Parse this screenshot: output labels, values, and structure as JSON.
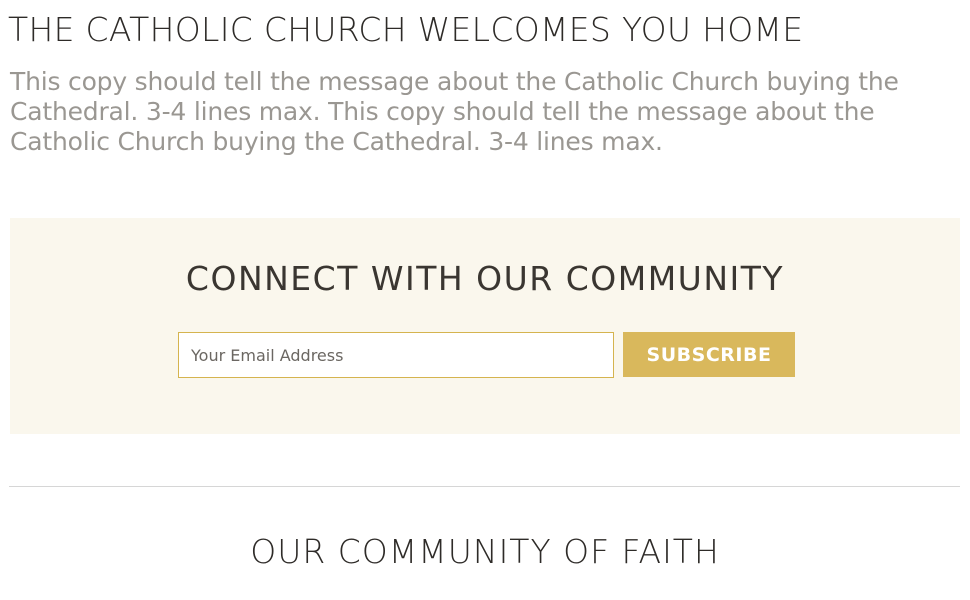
{
  "hero": {
    "title": "THE CATHOLIC CHURCH WELCOMES YOU HOME",
    "copy": "This copy should tell the message about the Catholic Church buying the Cathedral.  3-4 lines max.  This copy should tell the message about the Catholic Church buying the Cathedral.  3-4 lines max."
  },
  "connect": {
    "title": "CONNECT WITH OUR COMMUNITY",
    "email_placeholder": "Your Email Address",
    "subscribe_label": "SUBSCRIBE"
  },
  "community": {
    "title": "OUR COMMUNITY OF FAITH"
  },
  "colors": {
    "band_background": "#faf7ed",
    "accent_gold": "#d9b85c",
    "input_border": "#d5b44f",
    "body_text": "#9a9792",
    "heading_text": "#2e2b28",
    "divider": "#d6d6d6"
  }
}
